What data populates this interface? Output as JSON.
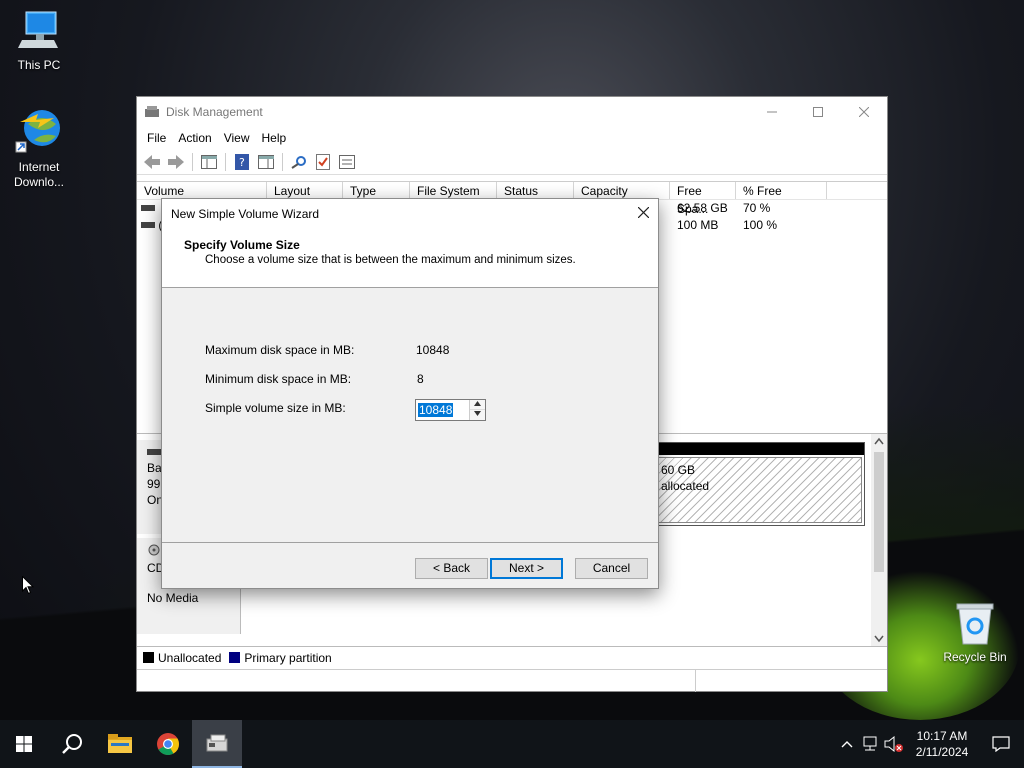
{
  "desktop": {
    "icons": [
      {
        "label": "This PC",
        "icon": "computer-icon"
      },
      {
        "label_line1": "Internet",
        "label_line2": "Downlo...",
        "icon": "idm-globe-icon"
      },
      {
        "label": "Recycle Bin",
        "icon": "recycle-bin-icon"
      }
    ]
  },
  "window": {
    "title": "Disk Management",
    "menu": [
      "File",
      "Action",
      "View",
      "Help"
    ],
    "volume_columns": [
      "Volume",
      "Layout",
      "Type",
      "File System",
      "Status",
      "Capacity",
      "Free Spa...",
      "% Free"
    ],
    "volume_rows": [
      {
        "volume": "",
        "free": "62.58 GB",
        "pct": "70 %"
      },
      {
        "volume": "(",
        "free": "100 MB",
        "pct": "100 %"
      }
    ],
    "disk0": {
      "line1": "Ba",
      "line2": "99.",
      "line3": "On",
      "unalloc_size": "60 GB",
      "unalloc_label": "allocated"
    },
    "cdrom": {
      "line1": "CD",
      "line2": "No Media"
    },
    "legend": [
      {
        "label": "Unallocated",
        "color": "#000000"
      },
      {
        "label": "Primary partition",
        "color": "#000080"
      }
    ]
  },
  "dialog": {
    "title": "New Simple Volume Wizard",
    "heading": "Specify Volume Size",
    "subheading": "Choose a volume size that is between the maximum and minimum sizes.",
    "max_label": "Maximum disk space in MB:",
    "max_value": "10848",
    "min_label": "Minimum disk space in MB:",
    "min_value": "8",
    "size_label": "Simple volume size in MB:",
    "size_value": "10848",
    "back_label": "< Back",
    "next_label": "Next >",
    "cancel_label": "Cancel"
  },
  "taskbar": {
    "time": "10:17 AM",
    "date": "2/11/2024"
  },
  "colors": {
    "accent": "#0078d7",
    "taskbar": "#101418"
  }
}
